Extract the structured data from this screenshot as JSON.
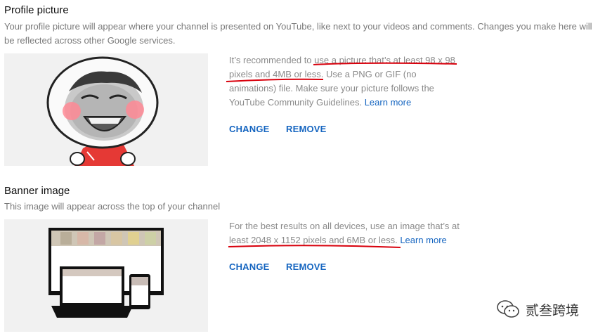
{
  "profile": {
    "title": "Profile picture",
    "description": "Your profile picture will appear where your channel is presented on YouTube, like next to your videos and comments. Changes you make here will be reflected across other Google services.",
    "info_pre": "It’s recommended to ",
    "info_emph": "use a picture that’s at least 98 x 98 pixels and 4MB or less",
    "info_post": ". Use a PNG or GIF (no animations) file. Make sure your picture follows the YouTube Community Guidelines. ",
    "learn_more": "Learn more",
    "change_label": "CHANGE",
    "remove_label": "REMOVE"
  },
  "banner": {
    "title": "Banner image",
    "description": "This image will appear across the top of your channel",
    "info_pre": "For the best results on all devices, use an image that’s at ",
    "info_emph": "least 2048 x 1152 pixels and 6MB or less",
    "info_post": ". ",
    "learn_more": "Learn more",
    "change_label": "CHANGE",
    "remove_label": "REMOVE"
  },
  "watermark": {
    "text": "贰叁跨境",
    "icon": "wechat-icon"
  },
  "colors": {
    "link": "#1565c0",
    "annotation": "#d8000c"
  }
}
